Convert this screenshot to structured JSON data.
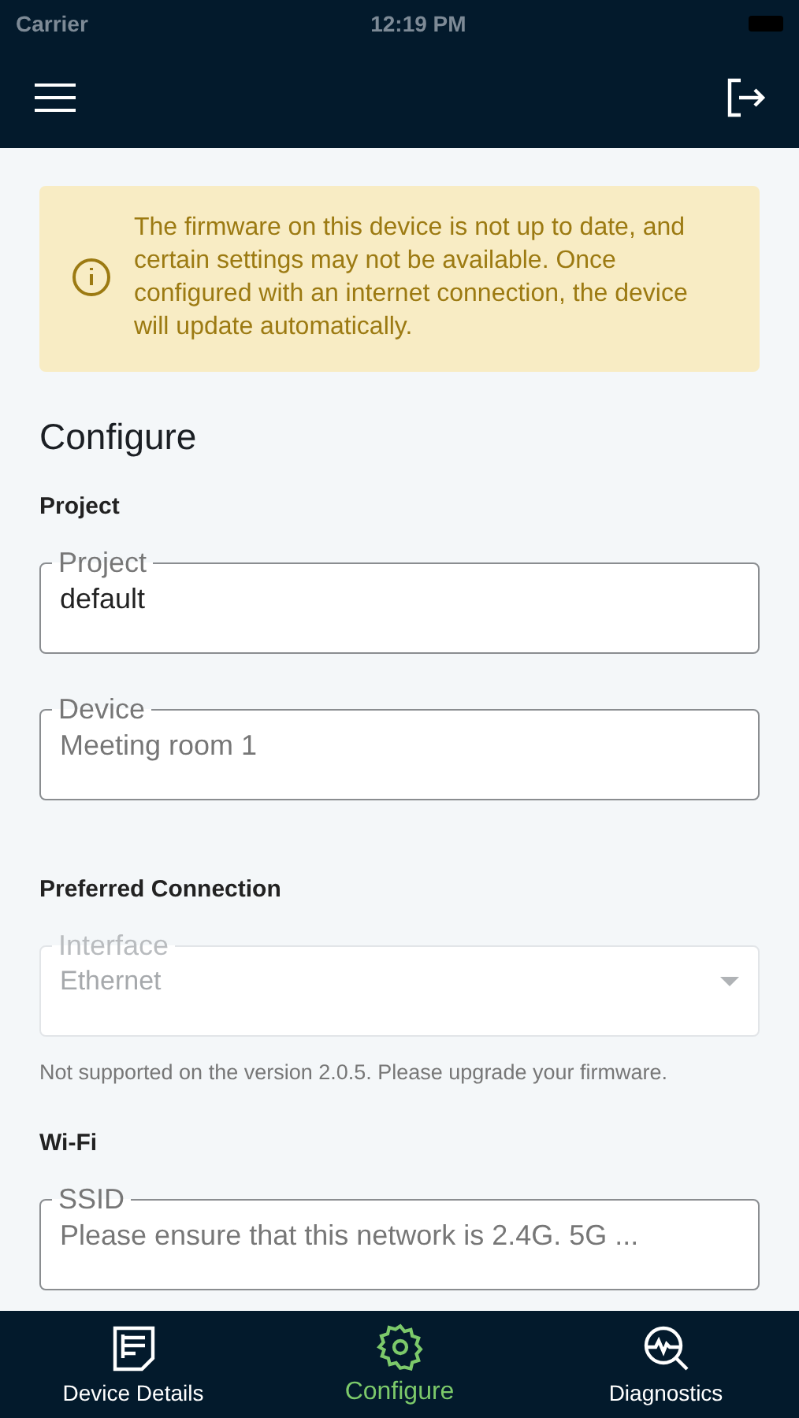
{
  "status_bar": {
    "carrier": "Carrier",
    "time": "12:19 PM"
  },
  "banner": {
    "text": "The firmware on this device is not up to date, and certain settings may not be available. Once configured with an internet connection, the device will update automatically."
  },
  "title": "Configure",
  "sections": [
    {
      "heading": "Project",
      "fields": [
        {
          "kind": "text",
          "label": "Project",
          "value": "default",
          "disabled": false
        },
        {
          "kind": "text",
          "label": "Device",
          "placeholder": "Meeting room 1",
          "disabled": false
        }
      ]
    },
    {
      "heading": "Preferred Connection",
      "fields": [
        {
          "kind": "select",
          "label": "Interface",
          "value": "Ethernet",
          "disabled": true,
          "helper": "Not supported on the version 2.0.5. Please upgrade your firmware."
        }
      ]
    },
    {
      "heading": "Wi-Fi",
      "fields": [
        {
          "kind": "text",
          "label": "SSID",
          "placeholder": "Please ensure that this network is 2.4G. 5G ...",
          "disabled": false
        }
      ]
    }
  ],
  "tabs": [
    {
      "label": "Device Details",
      "selected": false
    },
    {
      "label": "Configure",
      "selected": true
    },
    {
      "label": "Diagnostics",
      "selected": false
    }
  ]
}
